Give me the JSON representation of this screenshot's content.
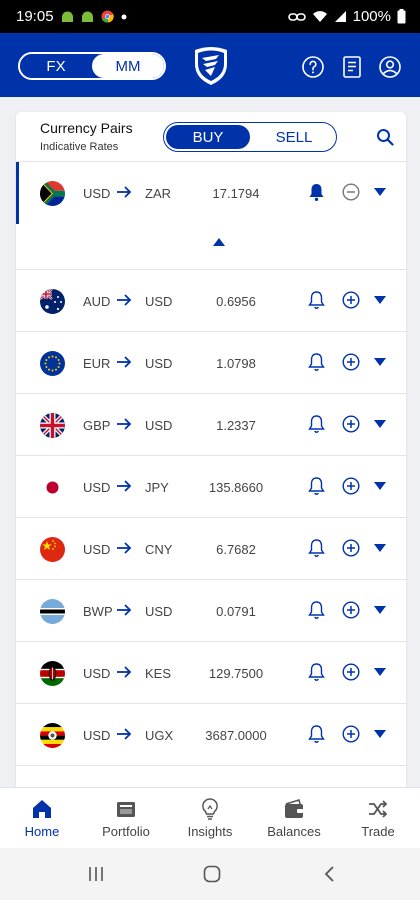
{
  "status_bar": {
    "time": "19:05",
    "battery": "100%"
  },
  "header": {
    "toggle_fx": "FX",
    "toggle_mm": "MM"
  },
  "card": {
    "title": "Currency Pairs",
    "subtitle": "Indicative Rates",
    "buy_label": "BUY",
    "sell_label": "SELL"
  },
  "rows": [
    {
      "from": "USD",
      "to": "ZAR",
      "rate": "17.1794",
      "flag": "za-flag",
      "selected": true
    },
    {
      "from": "AUD",
      "to": "USD",
      "rate": "0.6956",
      "flag": "au-flag"
    },
    {
      "from": "EUR",
      "to": "USD",
      "rate": "1.0798",
      "flag": "eu-flag"
    },
    {
      "from": "GBP",
      "to": "USD",
      "rate": "1.2337",
      "flag": "gb-flag"
    },
    {
      "from": "USD",
      "to": "JPY",
      "rate": "135.8660",
      "flag": "jp-flag"
    },
    {
      "from": "USD",
      "to": "CNY",
      "rate": "6.7682",
      "flag": "cn-flag"
    },
    {
      "from": "BWP",
      "to": "USD",
      "rate": "0.0791",
      "flag": "bw-flag"
    },
    {
      "from": "USD",
      "to": "KES",
      "rate": "129.7500",
      "flag": "ke-flag"
    },
    {
      "from": "USD",
      "to": "UGX",
      "rate": "3687.0000",
      "flag": "ug-flag"
    }
  ],
  "bottom_nav": [
    {
      "label": "Home",
      "icon": "home-icon",
      "active": true
    },
    {
      "label": "Portfolio",
      "icon": "portfolio-icon"
    },
    {
      "label": "Insights",
      "icon": "lightbulb-icon"
    },
    {
      "label": "Balances",
      "icon": "wallet-icon"
    },
    {
      "label": "Trade",
      "icon": "shuffle-icon"
    }
  ],
  "colors": {
    "brand": "#0033aa",
    "background": "#eef0f4"
  }
}
